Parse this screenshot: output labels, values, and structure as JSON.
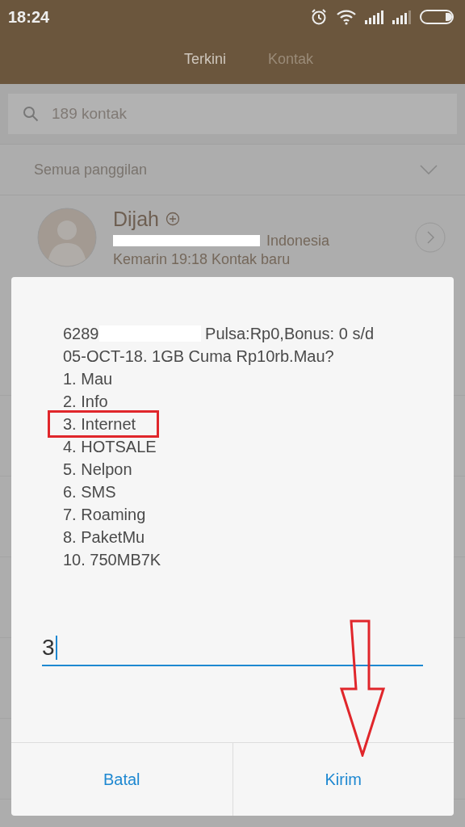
{
  "status_bar": {
    "time": "18:24"
  },
  "tabs": [
    {
      "label": "Terkini",
      "selected": true
    },
    {
      "label": "Kontak",
      "selected": false
    }
  ],
  "search": {
    "placeholder": "189 kontak"
  },
  "filter": {
    "label": "Semua panggilan"
  },
  "contact": {
    "name": "Dijah",
    "number_redacted": true,
    "region": "Indonesia",
    "detail": "Kemarin 19:18 Kontak baru"
  },
  "dialog": {
    "message_start": "6289",
    "message_rest": " Pulsa:Rp0,Bonus: 0 s/d 05-OCT-18. 1GB Cuma Rp10rb.Mau?",
    "options": [
      {
        "label": "1. Mau",
        "highlighted": false
      },
      {
        "label": "2. Info",
        "highlighted": false
      },
      {
        "label": "3. Internet",
        "highlighted": true
      },
      {
        "label": "4. HOTSALE",
        "highlighted": false
      },
      {
        "label": "5. Nelpon",
        "highlighted": false
      },
      {
        "label": "6. SMS",
        "highlighted": false
      },
      {
        "label": "7. Roaming",
        "highlighted": false
      },
      {
        "label": "8. PaketMu",
        "highlighted": false
      },
      {
        "label": "10. 750MB7K",
        "highlighted": false
      }
    ],
    "input": {
      "value": "3"
    },
    "buttons": [
      "Batal",
      "Kirim"
    ]
  }
}
